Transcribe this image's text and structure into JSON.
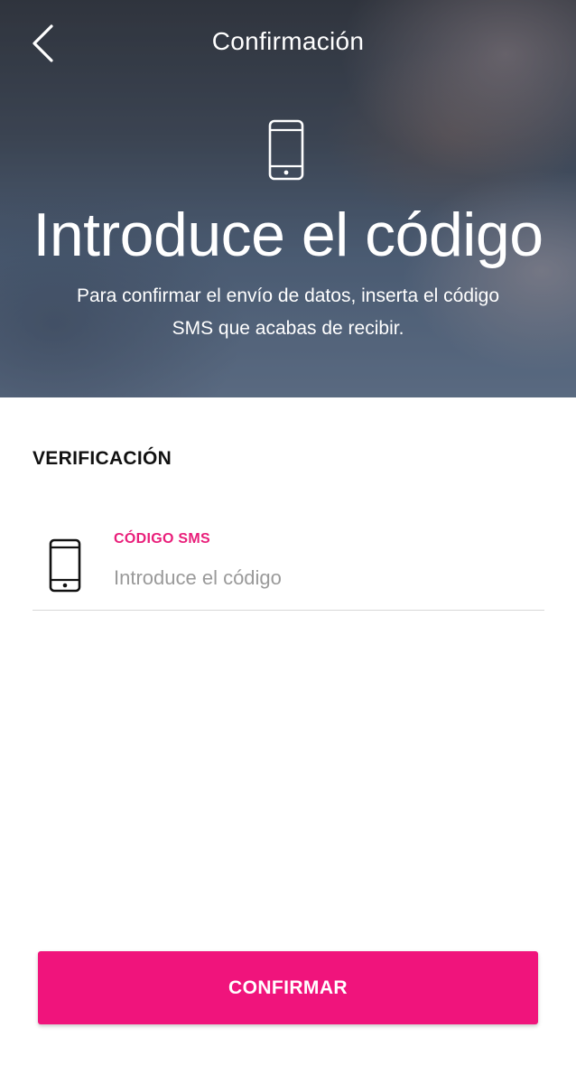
{
  "header": {
    "title": "Confirmación",
    "back_icon": "chevron-left-icon"
  },
  "hero": {
    "icon": "smartphone-icon",
    "title": "Introduce el código",
    "subtitle": "Para confirmar el envío de datos, inserta el código SMS que acabas de recibir."
  },
  "form": {
    "section_title": "VERIFICACIÓN",
    "sms_field": {
      "icon": "smartphone-icon",
      "label": "CÓDIGO SMS",
      "placeholder": "Introduce el código",
      "value": ""
    }
  },
  "actions": {
    "confirm_label": "CONFIRMAR"
  },
  "colors": {
    "accent": "#f0147c",
    "label_accent": "#e91e7a"
  }
}
